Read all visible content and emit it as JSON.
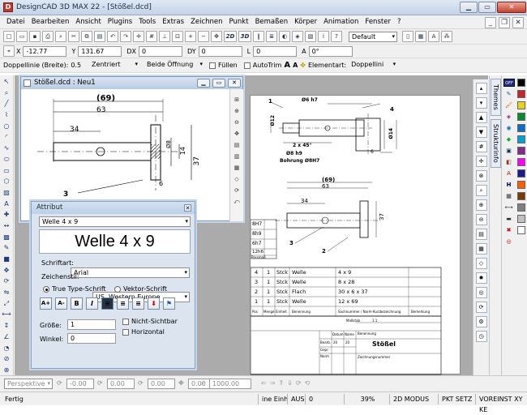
{
  "window": {
    "title": "DesignCAD 3D MAX 22 - [Stößel.dcd]",
    "app_icon": "D"
  },
  "menu": [
    "Datei",
    "Bearbeiten",
    "Ansicht",
    "Plugins",
    "Tools",
    "Extras",
    "Zeichnen",
    "Punkt",
    "Bemaßen",
    "Körper",
    "Animation",
    "Fenster",
    "?"
  ],
  "toolbar1": {
    "view_2d": "2D",
    "view_3d": "3D",
    "style_select": "Default"
  },
  "coords": {
    "x_label": "X",
    "x_value": "-12.77",
    "y_label": "Y",
    "y_value": "131.67",
    "dx_label": "DX",
    "dx_value": "0",
    "dy_label": "DY",
    "dy_value": "0",
    "l_label": "L",
    "l_value": "0",
    "a_label": "A",
    "a_value": "0°"
  },
  "line_bar": {
    "label": "Doppellinie (Breite):",
    "width": "0.5",
    "align": "Zentriert",
    "opening": "Beide Öffnung",
    "fill": "Füllen",
    "autotrim": "AutoTrim",
    "element_type": "Elementart:",
    "element_value": "Doppellini"
  },
  "child_window": {
    "title": "Stößel.dcd : Neu1"
  },
  "drawing": {
    "dim_overall": "(69)",
    "dim_63": "63",
    "dim_34": "34",
    "dim_37": "37",
    "dim_14": "14",
    "dim_6": "6",
    "dim_8": "Ø8",
    "callout_3": "3",
    "sheet_dims": {
      "d6h7": "Ø6 h7",
      "d12": "Ø12",
      "chamfer": "2 x 45°",
      "d8h9": "Ø8 h9",
      "d8h7": "Bohrung Ø8H7",
      "d14": "Ø14",
      "dim_6": "6",
      "c1": "1",
      "c4": "4",
      "c2": "2",
      "c3": "3",
      "sheet_69": "(69)",
      "sheet_63": "63",
      "sheet_34": "34",
      "sheet_37": "37"
    },
    "tol_rows": [
      "8H7",
      "8h9",
      "6h7",
      "12h6"
    ],
    "tol_head": "Passmaß",
    "parts": [
      {
        "pos": "4",
        "qty": "1",
        "unit": "Stck",
        "name": "Welle",
        "size": "4 x 9"
      },
      {
        "pos": "3",
        "qty": "1",
        "unit": "Stck",
        "name": "Welle",
        "size": "8 x 28"
      },
      {
        "pos": "2",
        "qty": "1",
        "unit": "Stck",
        "name": "Flach",
        "size": "30 x 6 x 37"
      },
      {
        "pos": "1",
        "qty": "1",
        "unit": "Stck",
        "name": "Welle",
        "size": "12 x 69"
      }
    ],
    "parts_head": [
      "Pos",
      "Menge",
      "Einheit",
      "Benennung",
      "Sachnummer / Norm-Kurzbezeichnung",
      "Bemerkung"
    ],
    "title_block": {
      "name": "Stößel",
      "scale_label": "Maßstab",
      "scale": "1:1",
      "zeichnungsnummer": "Zeichnungsnummer",
      "benennung": "Benennung",
      "datum": "Datum",
      "name_col": "Name",
      "bearb": "Bearb.",
      "gepr": "Gepr.",
      "norm": "Norm",
      "date_val": "20",
      "name_val": "20"
    }
  },
  "attr": {
    "title": "Attribut",
    "select_value": "Welle 4 x 9",
    "preview": "Welle 4 x 9",
    "font_label": "Schriftart:",
    "font_value": "Arial",
    "charset_label": "Zeichenstil:",
    "charset_value": "US, Western Europe",
    "radio_tt": "True Type-Schrift",
    "radio_vec": "Vektor-Schrift",
    "size_label": "Größe:",
    "size_value": "1",
    "angle_label": "Winkel:",
    "angle_value": "0",
    "invisible": "Nicht-Sichtbar",
    "horizontal": "Horizontal",
    "btn_a_plus": "A+",
    "btn_a_minus": "A-",
    "btn_b": "B",
    "btn_i": "I"
  },
  "side_tabs": {
    "themes": "Themes",
    "struct": "Strukturinfo"
  },
  "palette": {
    "off": "OFF",
    "colors": [
      "#1b1b8f",
      "#c1272d",
      "#0a8a34",
      "#e6b800",
      "#7f2c8a",
      "#0d6fbf",
      "#00a0a0",
      "#ff5f00",
      "#3b3b3b",
      "#ff00ff",
      "#7a3a00",
      "#00c000",
      "#0040ff",
      "#ffffff",
      "#808080"
    ]
  },
  "viewbar": {
    "view": "Perspektive",
    "v1": "-0.00",
    "v2": "0.00",
    "v3": "0.00",
    "v4": "0.00",
    "zoom": "1000.00"
  },
  "status": {
    "ready": "Fertig",
    "units": "ine Einh",
    "aus": "AUS",
    "zero": "0",
    "zoom": "39%",
    "mode": "2D MODUS",
    "pkt": "PKT SETZ",
    "vor": "VOREINST XY KE"
  }
}
